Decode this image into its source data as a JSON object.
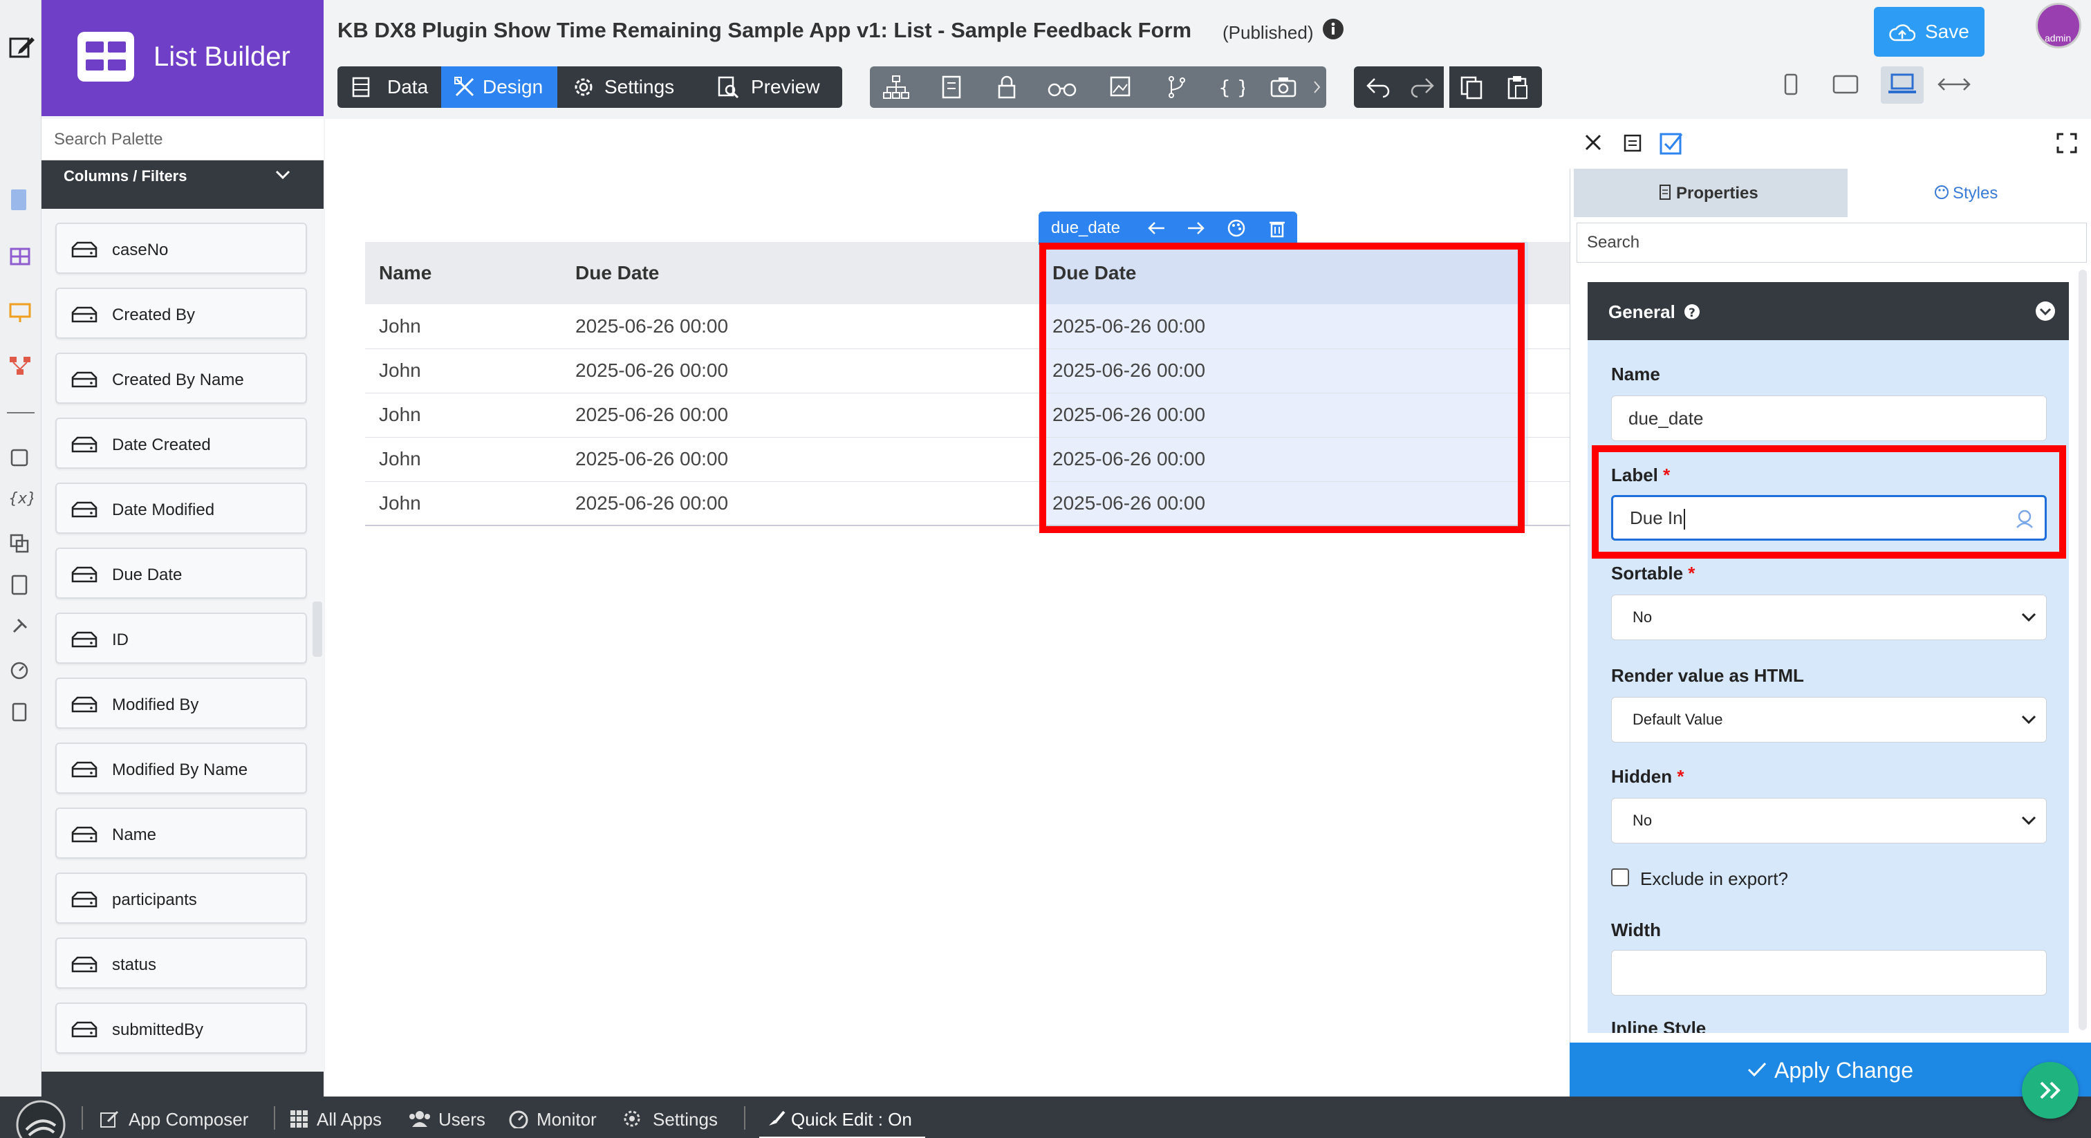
{
  "app": {
    "brand_title": "List Builder",
    "title": "KB DX8 Plugin Show Time Remaining Sample App v1: List - Sample Feedback Form",
    "status": "(Published)",
    "save_label": "Save",
    "avatar_text": "admin"
  },
  "toolbar": {
    "tabs": [
      {
        "label": "Data",
        "icon": "table-icon"
      },
      {
        "label": "Design",
        "icon": "design-icon",
        "active": true
      },
      {
        "label": "Settings",
        "icon": "gear-icon"
      },
      {
        "label": "Preview",
        "icon": "preview-icon"
      }
    ],
    "tools": [
      "tree-icon",
      "form-icon",
      "lock-icon",
      "binoculars-icon",
      "image-icon",
      "branch-icon",
      "braces-icon",
      "camera-icon"
    ],
    "history": [
      "undo-icon",
      "redo-icon"
    ],
    "clipboard": [
      "copy-icon",
      "paste-icon"
    ],
    "devices": [
      "phone-icon",
      "tablet-icon",
      "laptop-icon",
      "fullwidth-icon"
    ]
  },
  "palette": {
    "search_placeholder": "Search Palette",
    "category": "Columns / Filters",
    "items": [
      "caseNo",
      "Created By",
      "Created By Name",
      "Date Created",
      "Date Modified",
      "Due Date",
      "ID",
      "Modified By",
      "Modified By Name",
      "Name",
      "participants",
      "status",
      "submittedBy"
    ]
  },
  "table": {
    "selected_column": "due_date",
    "headers": [
      "Name",
      "Due Date",
      "Due Date"
    ],
    "rows": [
      [
        "John",
        "2025-06-26 00:00",
        "2025-06-26 00:00"
      ],
      [
        "John",
        "2025-06-26 00:00",
        "2025-06-26 00:00"
      ],
      [
        "John",
        "2025-06-26 00:00",
        "2025-06-26 00:00"
      ],
      [
        "John",
        "2025-06-26 00:00",
        "2025-06-26 00:00"
      ],
      [
        "John",
        "2025-06-26 00:00",
        "2025-06-26 00:00"
      ]
    ]
  },
  "properties": {
    "tab_properties": "Properties",
    "tab_styles": "Styles",
    "search_placeholder": "Search",
    "section": "General",
    "name_label": "Name",
    "name_value": "due_date",
    "label_label": "Label",
    "label_value": "Due In",
    "sortable_label": "Sortable",
    "sortable_value": "No",
    "render_html_label": "Render value as HTML",
    "render_html_value": "Default Value",
    "hidden_label": "Hidden",
    "hidden_value": "No",
    "exclude_label": "Exclude in export?",
    "width_label": "Width",
    "inline_style_label": "Inline Style",
    "required_mark": "*",
    "apply_label": "Apply Change"
  },
  "bottombar": {
    "items": [
      "App Composer",
      "All Apps",
      "Users",
      "Monitor",
      "Settings"
    ],
    "quick_edit": "Quick Edit : On"
  }
}
